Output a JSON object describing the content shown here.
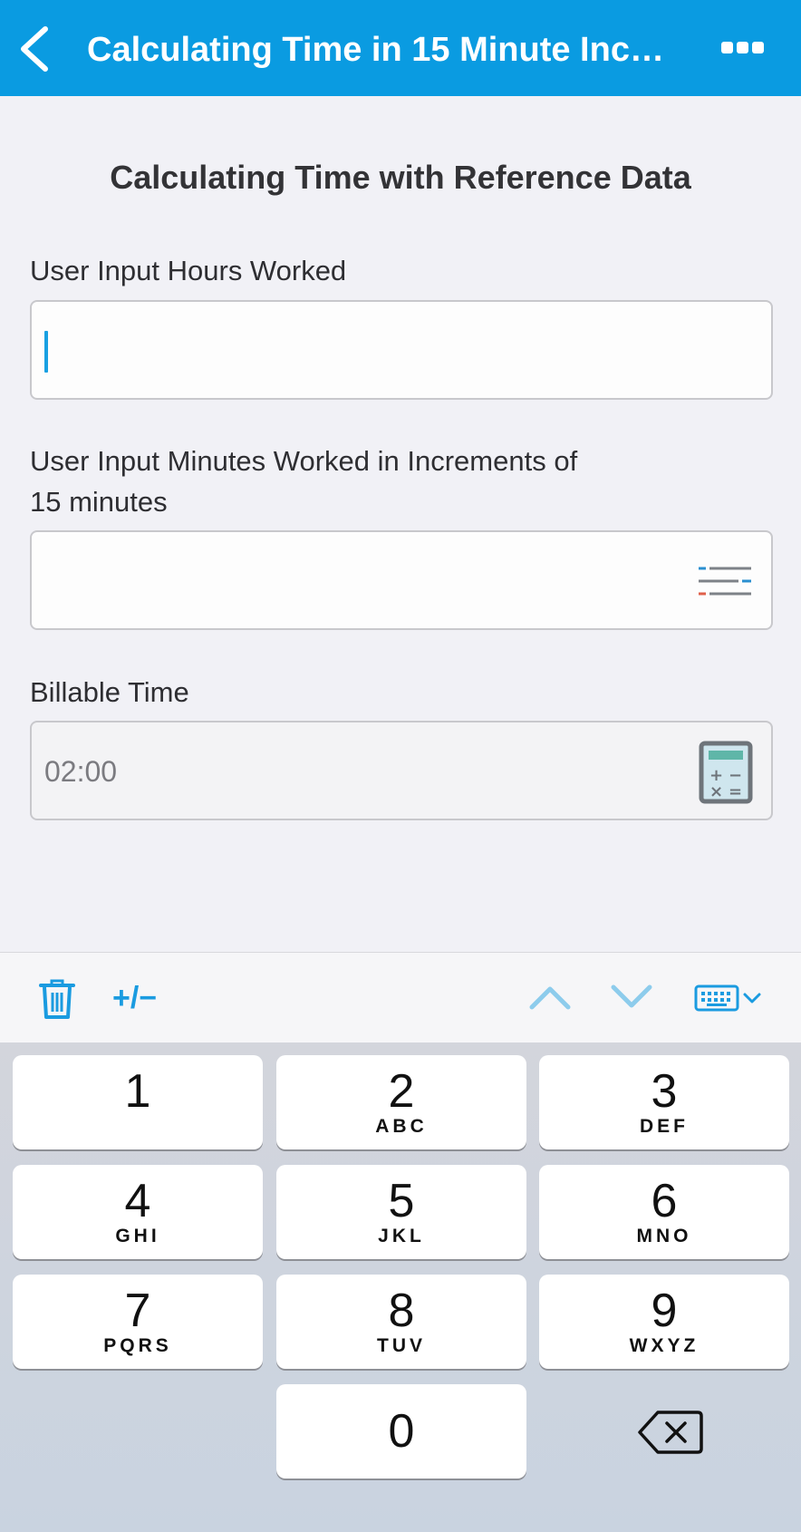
{
  "header": {
    "title": "Calculating Time in 15 Minute Incr...",
    "back_icon": "chevron-left-icon",
    "more_icon": "more-horizontal-icon",
    "bg_color": "#0a9be1"
  },
  "form": {
    "title": "Calculating Time with Reference Data",
    "fields": [
      {
        "label": "User Input Hours Worked",
        "value": ""
      },
      {
        "label": "User Input Minutes Worked in Increments of\n15 minutes",
        "value": "",
        "icon": "list-picker-icon"
      },
      {
        "label": "Billable Time",
        "value": "02:00",
        "icon": "calculator-icon",
        "readonly": true
      }
    ]
  },
  "toolbar": {
    "delete_icon": "trash-icon",
    "sign_toggle_label": "+/−",
    "prev_icon": "chevron-up-icon",
    "next_icon": "chevron-down-icon",
    "keyboard_icon": "keyboard-dismiss-icon",
    "accent_color": "#1a9be0"
  },
  "keypad": {
    "keys": [
      {
        "digit": "1",
        "letters": ""
      },
      {
        "digit": "2",
        "letters": "ABC"
      },
      {
        "digit": "3",
        "letters": "DEF"
      },
      {
        "digit": "4",
        "letters": "GHI"
      },
      {
        "digit": "5",
        "letters": "JKL"
      },
      {
        "digit": "6",
        "letters": "MNO"
      },
      {
        "digit": "7",
        "letters": "PQRS"
      },
      {
        "digit": "8",
        "letters": "TUV"
      },
      {
        "digit": "9",
        "letters": "WXYZ"
      },
      {
        "digit": "0",
        "letters": ""
      }
    ],
    "backspace_icon": "backspace-icon"
  }
}
